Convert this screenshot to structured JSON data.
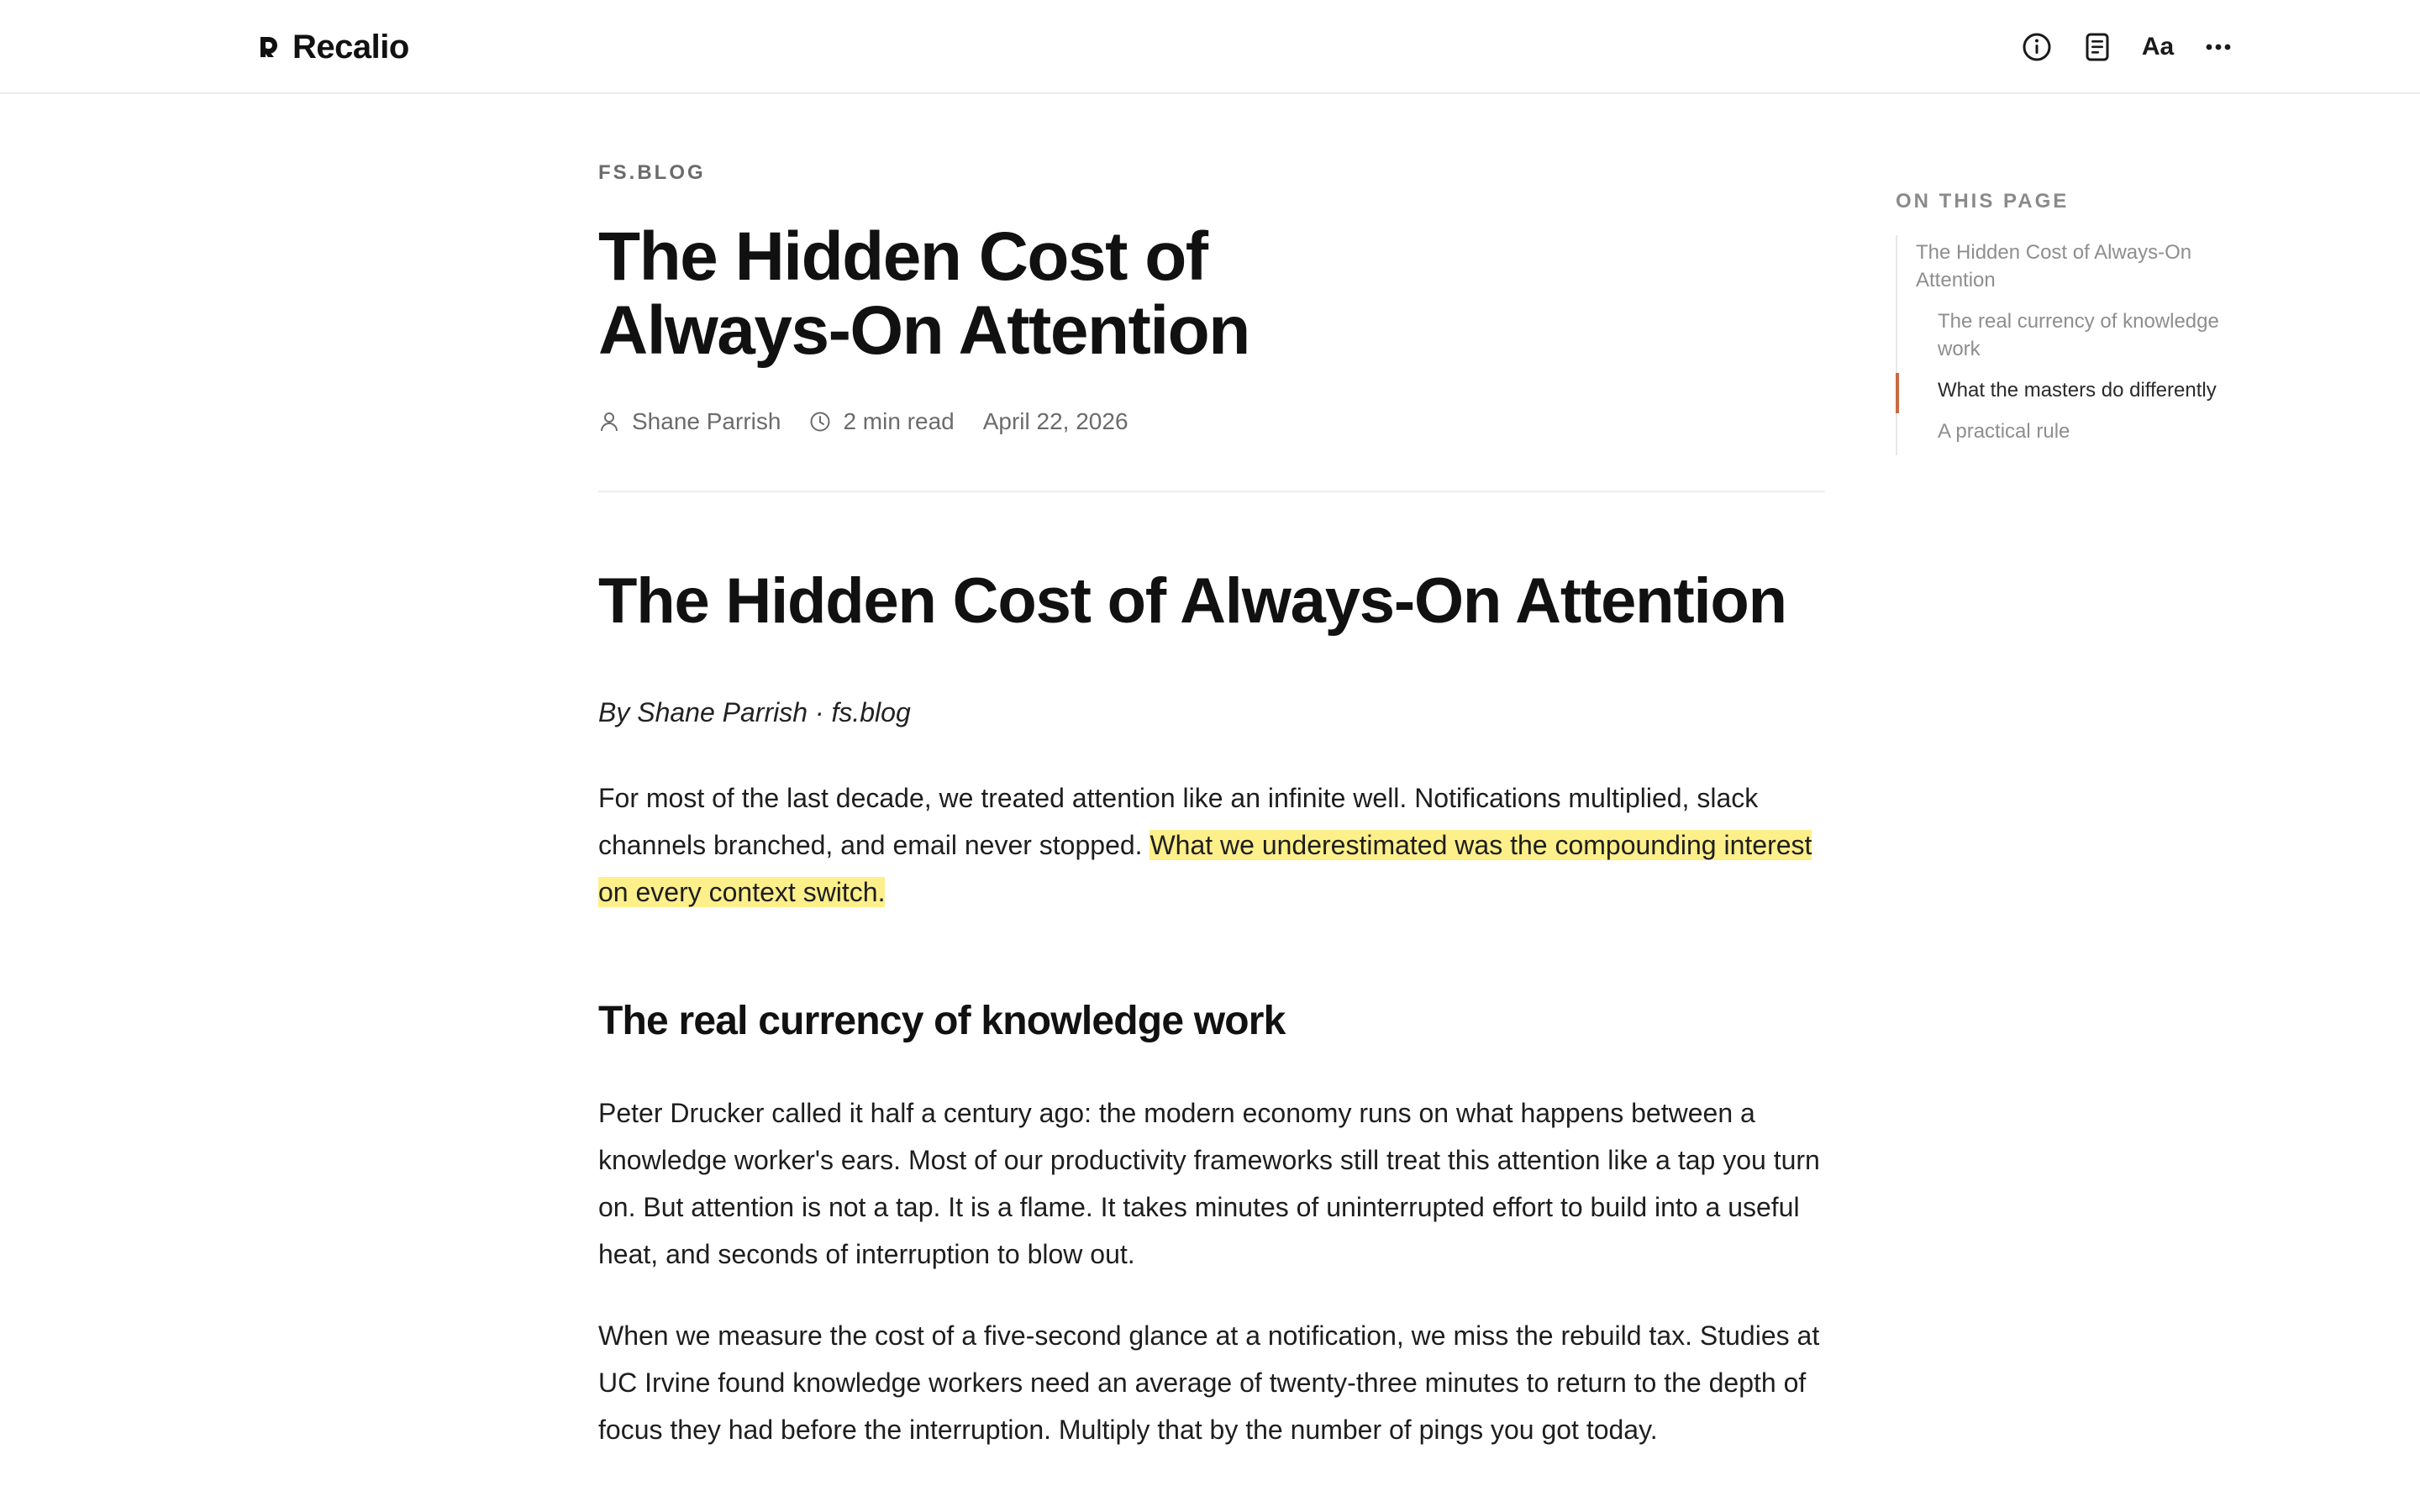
{
  "app": {
    "name": "Recalio",
    "toolbar": {
      "info_icon": "info-circle-icon",
      "reader_icon": "document-icon",
      "font_label": "Aa",
      "more_icon": "ellipsis-icon"
    }
  },
  "article": {
    "source": "FS.BLOG",
    "title": "The Hidden Cost of Always-On Attention",
    "meta": {
      "author": "Shane Parrish",
      "read_time": "2 min read",
      "date": "April 22, 2026"
    },
    "body": {
      "h1": "The Hidden Cost of Always-On Attention",
      "byline": "By Shane Parrish · fs.blog",
      "p1_plain": "For most of the last decade, we treated attention like an infinite well. Notifications multiplied, slack channels branched, and email never stopped. ",
      "p1_highlight": "What we underestimated was the compounding interest on every context switch.",
      "h2": "The real currency of knowledge work",
      "p2": "Peter Drucker called it half a century ago: the modern economy runs on what happens between a knowledge worker's ears. Most of our productivity frameworks still treat this attention like a tap you turn on. But attention is not a tap. It is a flame. It takes minutes of uninterrupted effort to build into a useful heat, and seconds of interruption to blow out.",
      "p3": "When we measure the cost of a five-second glance at a notification, we miss the rebuild tax. Studies at UC Irvine found knowledge workers need an average of twenty-three minutes to return to the depth of focus they had before the interruption. Multiply that by the number of pings you got today."
    },
    "highlight_color": "#fdef8a"
  },
  "toc": {
    "heading": "ON THIS PAGE",
    "items": [
      {
        "label": "The Hidden Cost of Always-On Attention",
        "level": 1,
        "active": false
      },
      {
        "label": "The real currency of knowledge work",
        "level": 2,
        "active": false
      },
      {
        "label": "What the masters do differently",
        "level": 2,
        "active": true
      },
      {
        "label": "A practical rule",
        "level": 2,
        "active": false
      }
    ],
    "active_color": "#c86a3e"
  }
}
